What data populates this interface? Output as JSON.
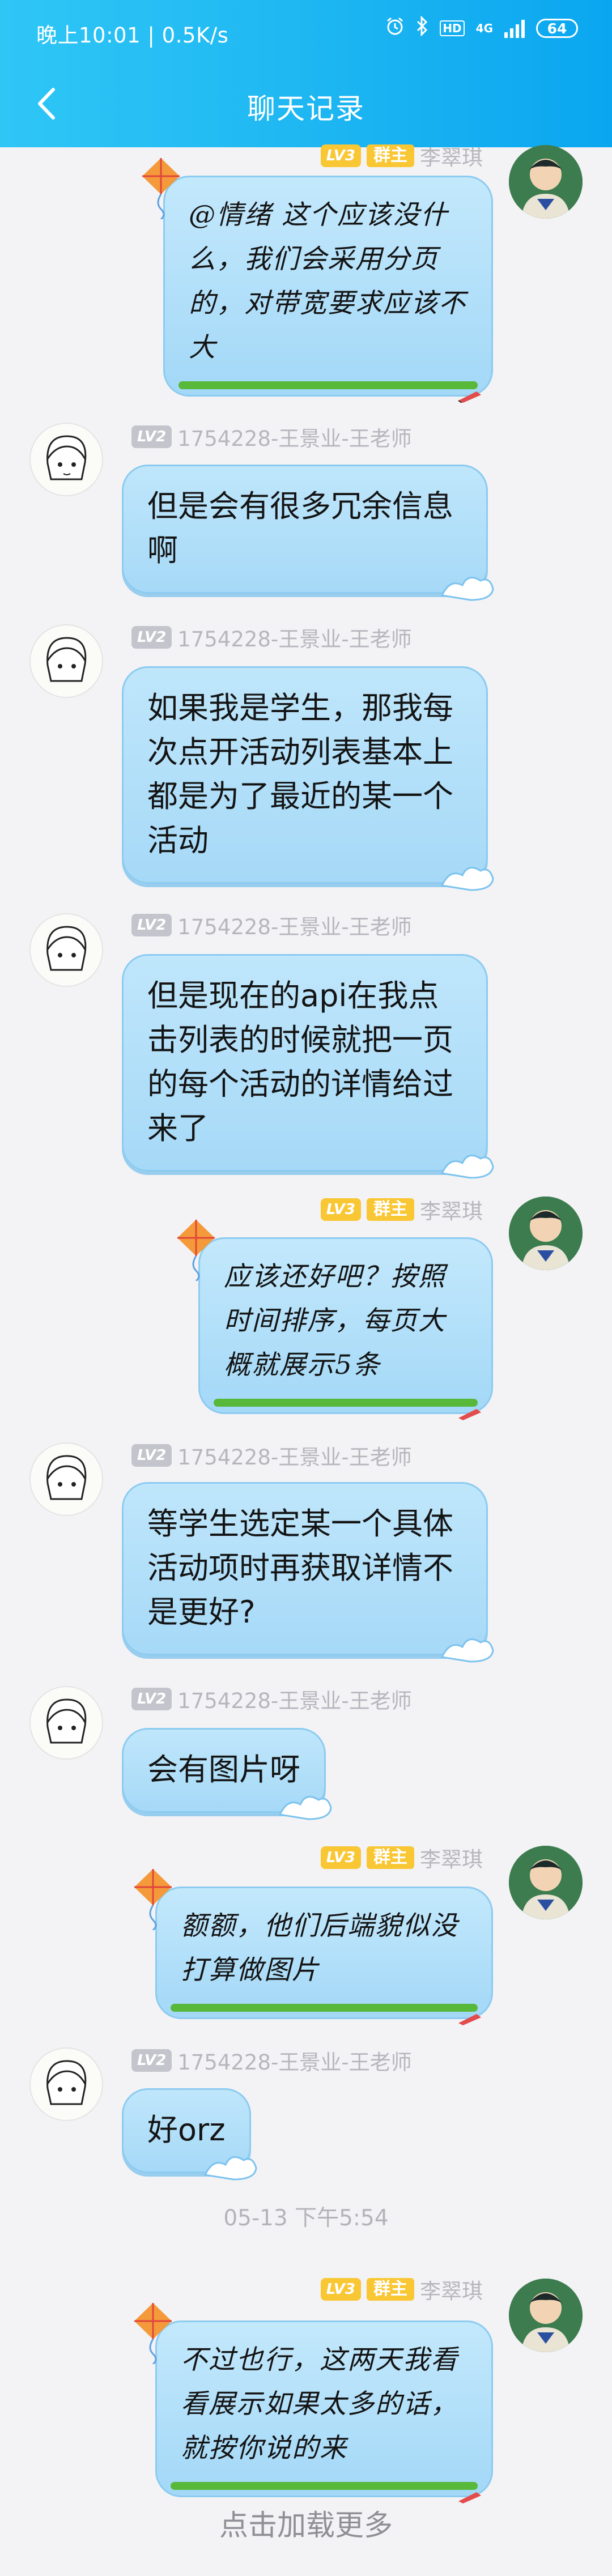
{
  "status_bar": {
    "time_speed": "晚上10:01 | 0.5K/s",
    "network_label": "4G",
    "hd_label": "HD",
    "battery": "64"
  },
  "header": {
    "title": "聊天记录"
  },
  "messages": [
    {
      "side": "right",
      "level": "LV3",
      "badge": "群主",
      "sender": "李翠琪",
      "text": "@情绪 这个应该没什么，我们会采用分页的，对带宽要求应该不大"
    },
    {
      "side": "left",
      "level": "LV2",
      "sender": "1754228-王景业-王老师",
      "text": "但是会有很多冗余信息啊"
    },
    {
      "side": "left",
      "level": "LV2",
      "sender": "1754228-王景业-王老师",
      "text": "如果我是学生，那我每次点开活动列表基本上都是为了最近的某一个活动"
    },
    {
      "side": "left",
      "level": "LV2",
      "sender": "1754228-王景业-王老师",
      "text": "但是现在的api在我点击列表的时候就把一页的每个活动的详情给过来了"
    },
    {
      "side": "right",
      "level": "LV3",
      "badge": "群主",
      "sender": "李翠琪",
      "text": "应该还好吧？按照时间排序，每页大概就展示5条"
    },
    {
      "side": "left",
      "level": "LV2",
      "sender": "1754228-王景业-王老师",
      "text": "等学生选定某一个具体活动项时再获取详情不是更好?"
    },
    {
      "side": "left",
      "level": "LV2",
      "sender": "1754228-王景业-王老师",
      "text": "会有图片呀"
    },
    {
      "side": "right",
      "level": "LV3",
      "badge": "群主",
      "sender": "李翠琪",
      "text": "额额，他们后端貌似没打算做图片"
    },
    {
      "side": "left",
      "level": "LV2",
      "sender": "1754228-王景业-王老师",
      "text": "好orz"
    },
    {
      "timestamp": "05-13 下午5:54"
    },
    {
      "side": "right",
      "level": "LV3",
      "badge": "群主",
      "sender": "李翠琪",
      "text": "不过也行，这两天我看看展示如果太多的话，就按你说的来"
    }
  ],
  "footer": {
    "load_more": "点击加载更多"
  },
  "colors": {
    "header_bg": "#1eb7f2",
    "bubble": "#a6d9f7",
    "owner_badge": "#f9c634",
    "level_gray": "#c4c4cc"
  }
}
